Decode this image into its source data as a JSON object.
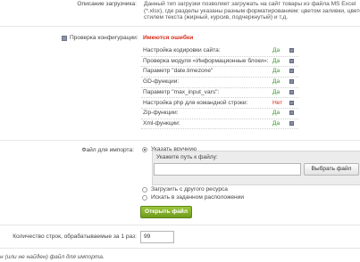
{
  "description": {
    "label": "Описание загрузчика:",
    "text": "Данный тип загрузки позволяет загружать на сайт товары из файла MS Excel (*.xlsx), где разделы указаны разным форматированием: цветом заливки, цветом стилем текста (жирный, курсив, подчеркнутый) и т.д."
  },
  "config": {
    "label": "Проверка конфигурации:",
    "status": "Имеются ошибки",
    "checks": [
      {
        "name": "Настройка кодировки сайта:",
        "result": "Да",
        "ok": true
      },
      {
        "name": "Проверка модуля «Информационные блоки»:",
        "result": "Да",
        "ok": true
      },
      {
        "name": "Параметр \"date.timezone\"",
        "result": "Да",
        "ok": true
      },
      {
        "name": "GD-функции:",
        "result": "Да",
        "ok": true
      },
      {
        "name": "Параметр \"max_input_vars\":",
        "result": "Да",
        "ok": true
      },
      {
        "name": "Настройка php для командной строки:",
        "result": "Нет",
        "ok": false
      },
      {
        "name": "Zip-функции:",
        "result": "Да",
        "ok": true
      },
      {
        "name": "Xml-функции:",
        "result": "Да",
        "ok": true
      }
    ]
  },
  "import": {
    "label": "Файл для импорта:",
    "option_manual": "Указать вручную",
    "path_label": "Укажите путь к файлу:",
    "path_value": "",
    "choose_button": "Выбрать файл",
    "option_remote": "Загрузить с другого ресурса",
    "option_search": "Искать в заданном расположении",
    "open_button": "Открыть файл"
  },
  "rows": {
    "label": "Количество строк, обрабатываемые за 1 раз:",
    "value": "99"
  },
  "footer_note": "н (или не найден) файл для импорта."
}
